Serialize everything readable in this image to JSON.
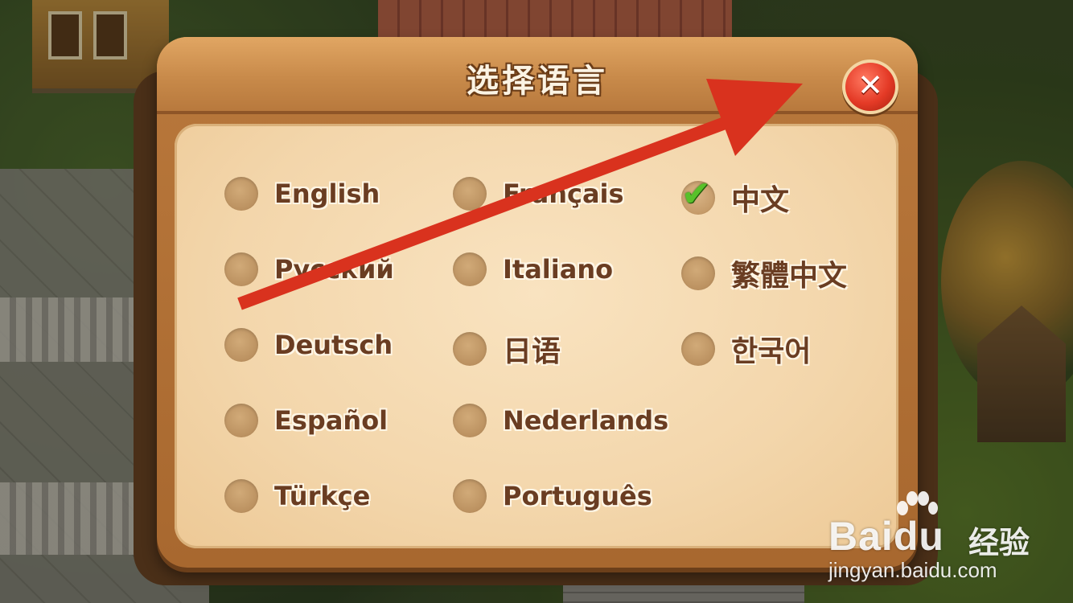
{
  "dialog": {
    "title": "选择语言",
    "close_icon": "close-x-icon"
  },
  "languages": [
    {
      "label": "English",
      "selected": false
    },
    {
      "label": "Français",
      "selected": false
    },
    {
      "label": "中文",
      "selected": true
    },
    {
      "label": "Русский",
      "selected": false
    },
    {
      "label": "Italiano",
      "selected": false
    },
    {
      "label": "繁體中文",
      "selected": false
    },
    {
      "label": "Deutsch",
      "selected": false
    },
    {
      "label": "日语",
      "selected": false
    },
    {
      "label": "한국어",
      "selected": false
    },
    {
      "label": "Español",
      "selected": false
    },
    {
      "label": "Nederlands",
      "selected": false
    },
    {
      "label": "Türkçe",
      "selected": false
    },
    {
      "label": "Português",
      "selected": false
    }
  ],
  "annotation": {
    "arrow_icon": "red-arrow-icon",
    "color": "#d9321e"
  },
  "watermark": {
    "brand_left": "Bai",
    "brand_right": "du",
    "brand_suffix": "经验",
    "url": "jingyan.baidu.com"
  }
}
